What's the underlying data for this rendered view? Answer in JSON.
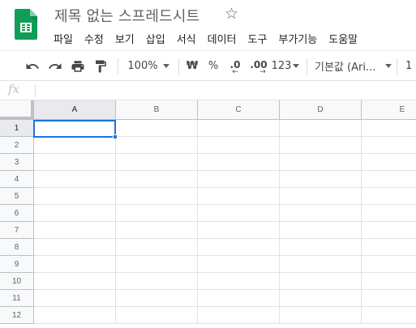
{
  "document": {
    "title": "제목 없는 스프레드시트",
    "star_icon": "star-outline-icon"
  },
  "menu": [
    "파일",
    "수정",
    "보기",
    "삽입",
    "서식",
    "데이터",
    "도구",
    "부가기능",
    "도움말"
  ],
  "toolbar": {
    "zoom": "100%",
    "currency": "₩",
    "percent": "%",
    "decrease_decimal": ".0",
    "increase_decimal": ".00",
    "more_formats": "123",
    "font": "기본값 (Ari...",
    "font_size": "1"
  },
  "formula_bar": {
    "fx_label": "fx",
    "value": ""
  },
  "grid": {
    "columns": [
      "A",
      "B",
      "C",
      "D",
      "E"
    ],
    "rows": [
      "1",
      "2",
      "3",
      "4",
      "5",
      "6",
      "7",
      "8",
      "9",
      "10",
      "11",
      "12"
    ],
    "selected_cell": "A1"
  },
  "colors": {
    "accent": "#1a73e8",
    "sheets_green": "#0f9d58"
  }
}
